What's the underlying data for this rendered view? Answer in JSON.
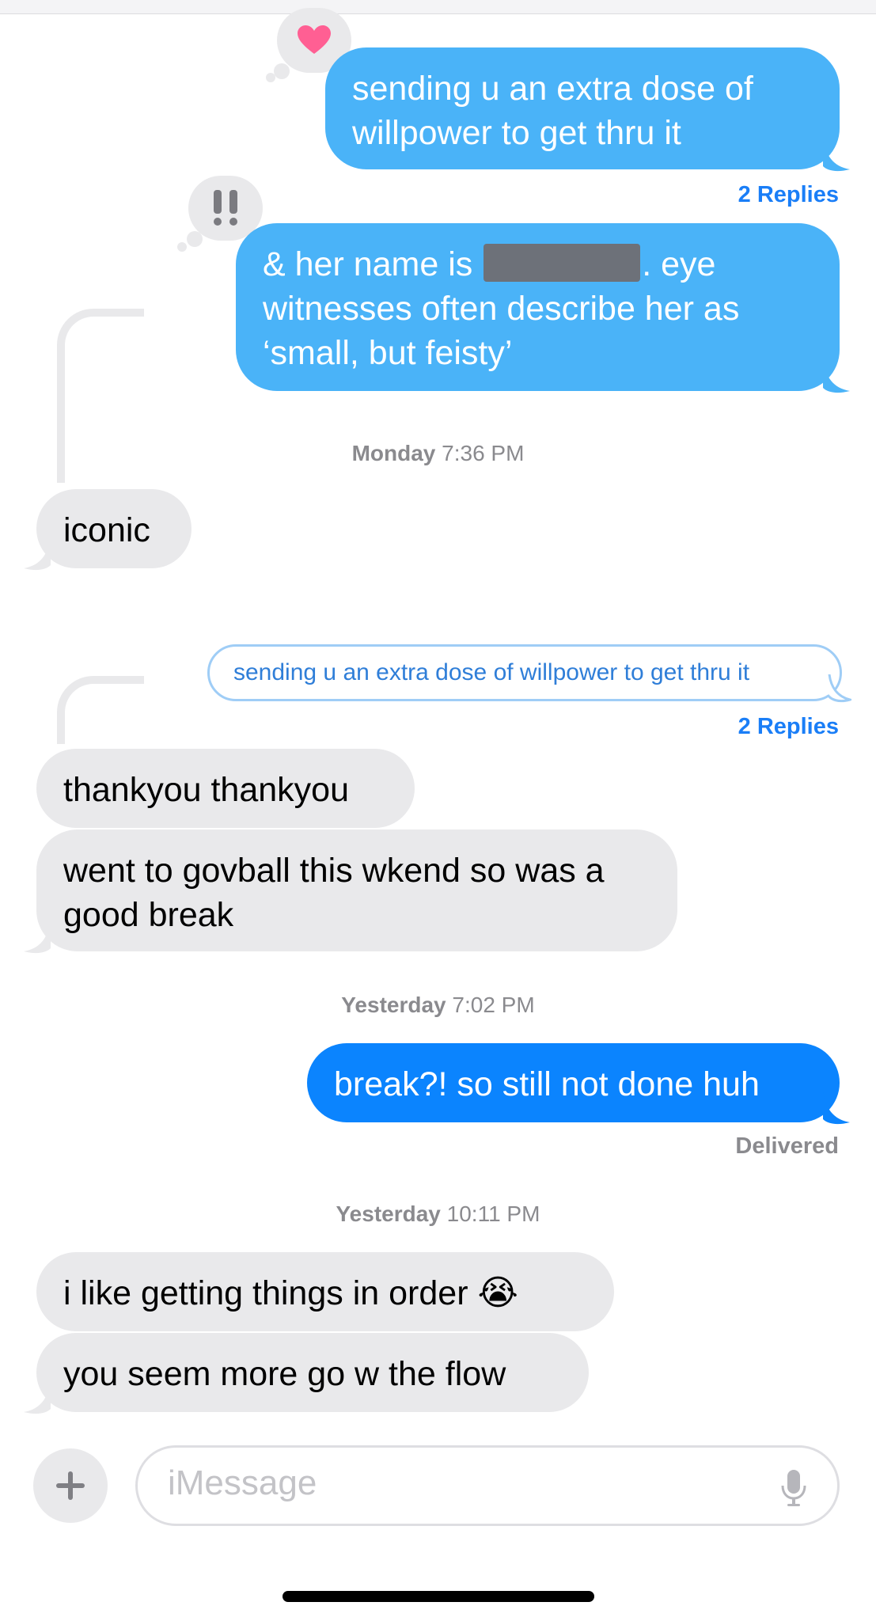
{
  "conversation": {
    "msg1": {
      "text": "sending u an extra dose of willpower to get thru it",
      "reaction": "heart-icon"
    },
    "replies1": "2 Replies",
    "msg2": {
      "text_before": "& her name is",
      "text_after": ". eye witnesses often describe her as ‘small, but feisty’",
      "reaction": "double-exclamation"
    },
    "ts1": {
      "day": "Monday",
      "time": "7:36 PM"
    },
    "msg3": "iconic",
    "quote": "sending u an extra dose of willpower to get thru it",
    "replies2": "2 Replies",
    "msg4": "thankyou thankyou",
    "msg5": "went to govball this wkend so was a good break",
    "ts2": {
      "day": "Yesterday",
      "time": "7:02 PM"
    },
    "msg6": "break?! so still not done huh",
    "delivered": "Delivered",
    "ts3": {
      "day": "Yesterday",
      "time": "10:11 PM"
    },
    "msg7": {
      "text": "i like getting things in order",
      "emoji": "😭"
    },
    "msg8": "you seem more go w the flow"
  },
  "composer": {
    "placeholder": "iMessage",
    "plus_icon": "plus-icon",
    "mic_icon": "microphone-icon"
  },
  "colors": {
    "sent": "#0b84fe",
    "sent_thread": "#4ab3f8",
    "received": "#e9e9eb",
    "link": "#1a7ef7"
  }
}
